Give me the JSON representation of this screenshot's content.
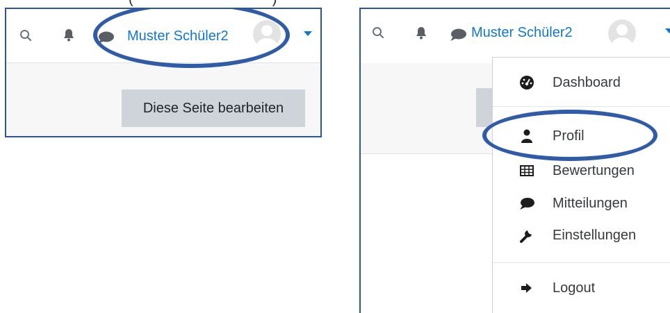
{
  "caption_fragment": "(                                    )",
  "left_panel": {
    "navbar": {
      "icons": [
        "search-icon",
        "bell-icon",
        "chat-icon",
        "caret-down-icon"
      ],
      "user_name": "Muster Schüler2",
      "avatar": "default-user-avatar"
    },
    "edit_button_label": "Diese Seite bearbeiten",
    "highlight_color": "#2f5ba8"
  },
  "right_panel": {
    "navbar": {
      "icons": [
        "search-icon",
        "bell-icon",
        "chat-icon",
        "caret-down-icon"
      ],
      "user_name": "Muster Schüler2",
      "avatar": "default-user-avatar"
    },
    "menu": [
      {
        "icon": "dashboard-icon",
        "label": "Dashboard"
      },
      {
        "icon": "user-icon",
        "label": "Profil"
      },
      {
        "icon": "table-icon",
        "label": "Bewertungen"
      },
      {
        "icon": "chat-icon",
        "label": "Mitteilungen"
      },
      {
        "icon": "wrench-icon",
        "label": "Einstellungen"
      },
      {
        "icon": "logout-icon",
        "label": "Logout"
      }
    ],
    "highlight_color": "#2f5ba8"
  },
  "colors": {
    "link": "#1177d1",
    "button_bg": "#ced4da",
    "page_bg": "#f7f7f7",
    "frame_border": "#2c5596"
  }
}
